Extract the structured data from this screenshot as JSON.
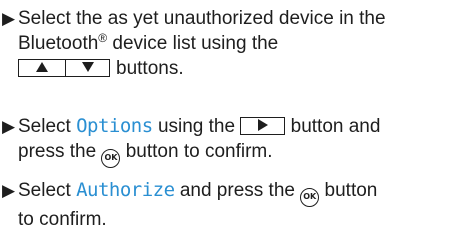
{
  "steps": [
    {
      "marker": "▶",
      "lines": [
        "Select the as yet unauthorized device in the",
        "Bluetooth",
        "® device list using the",
        "buttons."
      ],
      "keys": [
        "up",
        "down"
      ]
    },
    {
      "marker": "▶",
      "pre": "Select ",
      "keyword": "Options",
      "mid": " using the ",
      "post": " button and",
      "line2_pre": "press the ",
      "ok_label": "OK",
      "line2_post": " button to confirm.",
      "keys": [
        "right"
      ]
    },
    {
      "marker": "▶",
      "pre": "Select ",
      "keyword": "Authorize",
      "mid": " and press the ",
      "ok_label": "OK",
      "post": " button",
      "line2": "to confirm."
    }
  ],
  "icons": {
    "up": "up-arrow-key-icon",
    "down": "down-arrow-key-icon",
    "right": "right-arrow-key-icon",
    "ok": "ok-button-icon"
  },
  "colors": {
    "text": "#1e1e1e",
    "keyword": "#2a8fd2"
  }
}
